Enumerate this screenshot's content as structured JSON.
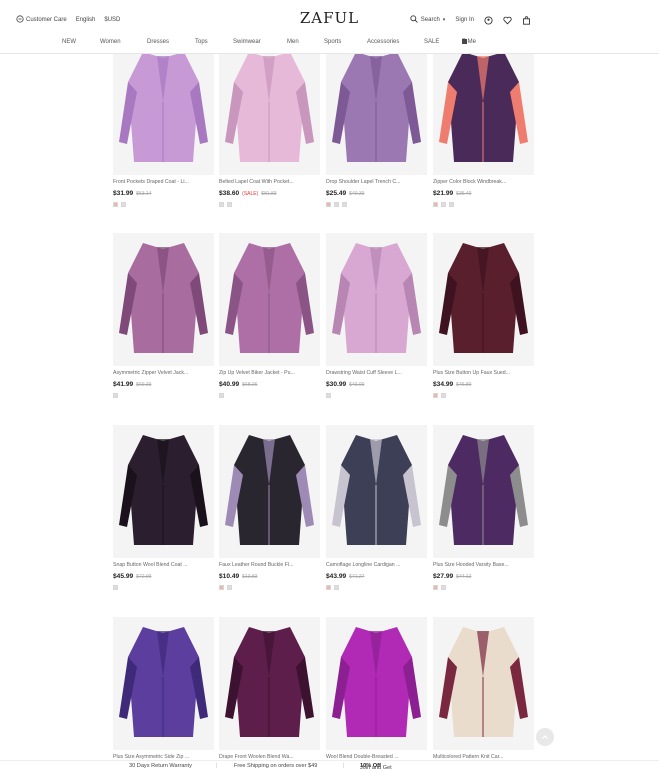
{
  "header": {
    "customer_care": "Customer Care",
    "language": "English",
    "currency": "$USD",
    "logo": "ZAFUL",
    "search_label": "Search",
    "sign_in": "Sign In",
    "icons": [
      "chat-icon",
      "search-icon",
      "user-circle-icon",
      "heart-icon",
      "bag-icon"
    ]
  },
  "nav": {
    "items": [
      "NEW",
      "Women",
      "Dresses",
      "Tops",
      "Swimwear",
      "Men",
      "Sports",
      "Accessories",
      "SALE",
      "Z-Me"
    ]
  },
  "products": [
    {
      "name": "Front Pockets Draped Coat - Li...",
      "price": "$31.99",
      "tag": "",
      "old_price": "$53.14",
      "swatches": [
        "#e8b9a6",
        "#ddd"
      ],
      "colors": [
        "#c79ad6",
        "#a878c0"
      ]
    },
    {
      "name": "Belted Lapel Coat With Pocket...",
      "price": "$38.60",
      "tag": "(SALE)",
      "old_price": "$81.83",
      "swatches": [
        "#ddd",
        "#ddd"
      ],
      "colors": [
        "#e6b9d8",
        "#c996bd"
      ]
    },
    {
      "name": "Drop Shoulder Lapel Trench C...",
      "price": "$25.49",
      "tag": "",
      "old_price": "$40.39",
      "swatches": [
        "#e8b9a6",
        "#ddd",
        "#ddd"
      ],
      "colors": [
        "#9c78b3",
        "#7d5a96"
      ]
    },
    {
      "name": "Zipper Color Block Windbreak...",
      "price": "$21.99",
      "tag": "",
      "old_price": "$35.49",
      "swatches": [
        "#e8b9a6",
        "#ddd",
        "#ddd"
      ],
      "colors": [
        "#4a2a58",
        "#ef7d6f"
      ]
    },
    {
      "name": "Asymmetric Zipper Velvet Jack...",
      "price": "$41.99",
      "tag": "",
      "old_price": "$69.33",
      "swatches": [
        "#ddd"
      ],
      "colors": [
        "#a86c9f",
        "#7f4a79"
      ]
    },
    {
      "name": "Zip Up Velvet Biker Jacket - Pu...",
      "price": "$40.99",
      "tag": "",
      "old_price": "$68.26",
      "swatches": [
        "#ddd"
      ],
      "colors": [
        "#ad6fa6",
        "#8a5586"
      ]
    },
    {
      "name": "Drawstring Waist Cuff Sleeve L...",
      "price": "$30.99",
      "tag": "",
      "old_price": "$43.00",
      "swatches": [
        "#ddd"
      ],
      "colors": [
        "#d8a8d2",
        "#b786b3"
      ]
    },
    {
      "name": "Plus Size Button Up Faux Sued...",
      "price": "$34.99",
      "tag": "",
      "old_price": "$46.80",
      "swatches": [
        "#e8b9a6",
        "#ddd"
      ],
      "colors": [
        "#5a1f2c",
        "#3e1220"
      ]
    },
    {
      "name": "Snap Button Wool Blend Coat ...",
      "price": "$45.99",
      "tag": "",
      "old_price": "$72.99",
      "swatches": [
        "#ddd"
      ],
      "colors": [
        "#2b1e2e",
        "#1a111c"
      ]
    },
    {
      "name": "Faux Leather Round Buckle Fl...",
      "price": "$10.49",
      "tag": "",
      "old_price": "$13.83",
      "swatches": [
        "#e8b9a6",
        "#ddd"
      ],
      "colors": [
        "#2a2630",
        "#9e8bb5"
      ]
    },
    {
      "name": "Camoflage Longline Cardigan ...",
      "price": "$43.99",
      "tag": "",
      "old_price": "$71.27",
      "swatches": [
        "#e8b9a6",
        "#ddd"
      ],
      "colors": [
        "#3c3f55",
        "#c8c4cf"
      ]
    },
    {
      "name": "Plus Size Hooded Varsity Base...",
      "price": "$27.99",
      "tag": "",
      "old_price": "$44.12",
      "swatches": [
        "#e8b9a6",
        "#ddd"
      ],
      "colors": [
        "#4e2a63",
        "#8d8d8d"
      ]
    },
    {
      "name": "Plus Size Asymmetric Side Zip ...",
      "price": "",
      "tag": "",
      "old_price": "",
      "swatches": [],
      "colors": [
        "#5b3e9e",
        "#3f2a7a"
      ]
    },
    {
      "name": "Drape Front Woolen Blend Wa...",
      "price": "",
      "tag": "",
      "old_price": "",
      "swatches": [],
      "colors": [
        "#5e1e4c",
        "#3d1231"
      ]
    },
    {
      "name": "Wool Blend Double-Breasted ...",
      "price": "",
      "tag": "",
      "old_price": "",
      "swatches": [],
      "colors": [
        "#b02ab5",
        "#8c1f91"
      ]
    },
    {
      "name": "Multicolored Pattern Knit Car...",
      "price": "",
      "tag": "",
      "old_price": "",
      "swatches": [],
      "colors": [
        "#e9dccd",
        "#7a2840"
      ]
    }
  ],
  "footer": {
    "warranty": "30 Days Return Warranty",
    "shipping": "Free Shipping on orders over $49",
    "join_prefix": "Join and Get",
    "join_offer": "10% Off"
  }
}
